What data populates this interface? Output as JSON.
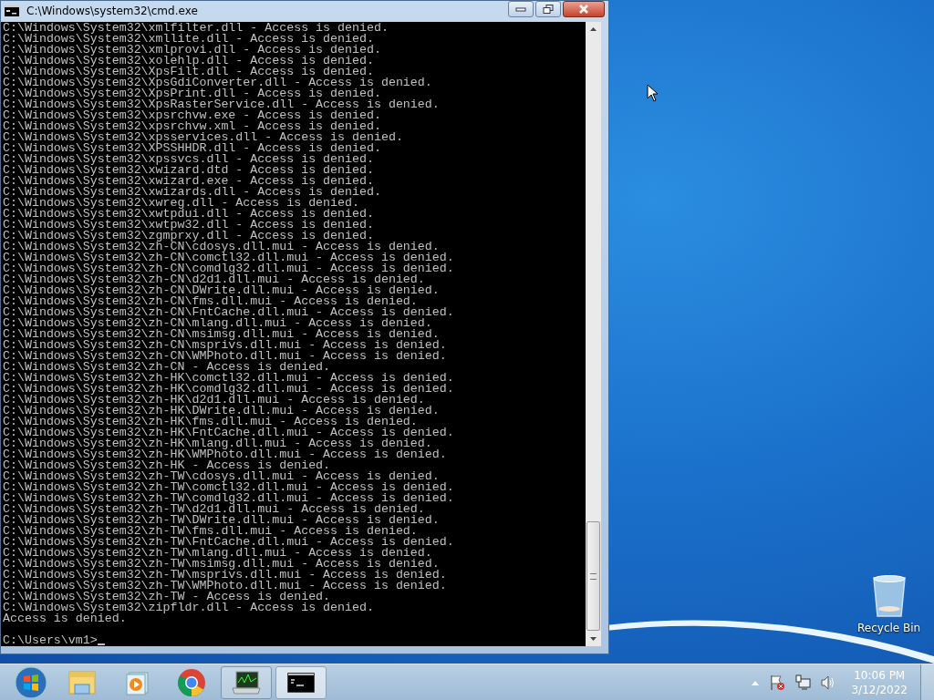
{
  "window": {
    "title": "C:\\Windows\\system32\\cmd.exe"
  },
  "console": {
    "lines": [
      "C:\\Windows\\System32\\xmlfilter.dll - Access is denied.",
      "C:\\Windows\\System32\\xmllite.dll - Access is denied.",
      "C:\\Windows\\System32\\xmlprovi.dll - Access is denied.",
      "C:\\Windows\\System32\\xolehlp.dll - Access is denied.",
      "C:\\Windows\\System32\\XpsFilt.dll - Access is denied.",
      "C:\\Windows\\System32\\XpsGdiConverter.dll - Access is denied.",
      "C:\\Windows\\System32\\XpsPrint.dll - Access is denied.",
      "C:\\Windows\\System32\\XpsRasterService.dll - Access is denied.",
      "C:\\Windows\\System32\\xpsrchvw.exe - Access is denied.",
      "C:\\Windows\\System32\\xpsrchvw.xml - Access is denied.",
      "C:\\Windows\\System32\\xpsservices.dll - Access is denied.",
      "C:\\Windows\\System32\\XPSSHHDR.dll - Access is denied.",
      "C:\\Windows\\System32\\xpssvcs.dll - Access is denied.",
      "C:\\Windows\\System32\\xwizard.dtd - Access is denied.",
      "C:\\Windows\\System32\\xwizard.exe - Access is denied.",
      "C:\\Windows\\System32\\xwizards.dll - Access is denied.",
      "C:\\Windows\\System32\\xwreg.dll - Access is denied.",
      "C:\\Windows\\System32\\xwtpdui.dll - Access is denied.",
      "C:\\Windows\\System32\\xwtpw32.dll - Access is denied.",
      "C:\\Windows\\System32\\zgmprxy.dll - Access is denied.",
      "C:\\Windows\\System32\\zh-CN\\cdosys.dll.mui - Access is denied.",
      "C:\\Windows\\System32\\zh-CN\\comctl32.dll.mui - Access is denied.",
      "C:\\Windows\\System32\\zh-CN\\comdlg32.dll.mui - Access is denied.",
      "C:\\Windows\\System32\\zh-CN\\d2d1.dll.mui - Access is denied.",
      "C:\\Windows\\System32\\zh-CN\\DWrite.dll.mui - Access is denied.",
      "C:\\Windows\\System32\\zh-CN\\fms.dll.mui - Access is denied.",
      "C:\\Windows\\System32\\zh-CN\\FntCache.dll.mui - Access is denied.",
      "C:\\Windows\\System32\\zh-CN\\mlang.dll.mui - Access is denied.",
      "C:\\Windows\\System32\\zh-CN\\msimsg.dll.mui - Access is denied.",
      "C:\\Windows\\System32\\zh-CN\\msprivs.dll.mui - Access is denied.",
      "C:\\Windows\\System32\\zh-CN\\WMPhoto.dll.mui - Access is denied.",
      "C:\\Windows\\System32\\zh-CN - Access is denied.",
      "C:\\Windows\\System32\\zh-HK\\comctl32.dll.mui - Access is denied.",
      "C:\\Windows\\System32\\zh-HK\\comdlg32.dll.mui - Access is denied.",
      "C:\\Windows\\System32\\zh-HK\\d2d1.dll.mui - Access is denied.",
      "C:\\Windows\\System32\\zh-HK\\DWrite.dll.mui - Access is denied.",
      "C:\\Windows\\System32\\zh-HK\\fms.dll.mui - Access is denied.",
      "C:\\Windows\\System32\\zh-HK\\FntCache.dll.mui - Access is denied.",
      "C:\\Windows\\System32\\zh-HK\\mlang.dll.mui - Access is denied.",
      "C:\\Windows\\System32\\zh-HK\\WMPhoto.dll.mui - Access is denied.",
      "C:\\Windows\\System32\\zh-HK - Access is denied.",
      "C:\\Windows\\System32\\zh-TW\\cdosys.dll.mui - Access is denied.",
      "C:\\Windows\\System32\\zh-TW\\comctl32.dll.mui - Access is denied.",
      "C:\\Windows\\System32\\zh-TW\\comdlg32.dll.mui - Access is denied.",
      "C:\\Windows\\System32\\zh-TW\\d2d1.dll.mui - Access is denied.",
      "C:\\Windows\\System32\\zh-TW\\DWrite.dll.mui - Access is denied.",
      "C:\\Windows\\System32\\zh-TW\\fms.dll.mui - Access is denied.",
      "C:\\Windows\\System32\\zh-TW\\FntCache.dll.mui - Access is denied.",
      "C:\\Windows\\System32\\zh-TW\\mlang.dll.mui - Access is denied.",
      "C:\\Windows\\System32\\zh-TW\\msimsg.dll.mui - Access is denied.",
      "C:\\Windows\\System32\\zh-TW\\msprivs.dll.mui - Access is denied.",
      "C:\\Windows\\System32\\zh-TW\\WMPhoto.dll.mui - Access is denied.",
      "C:\\Windows\\System32\\zh-TW - Access is denied.",
      "C:\\Windows\\System32\\zipfldr.dll - Access is denied.",
      "Access is denied."
    ],
    "prompt": "C:\\Users\\vm1>"
  },
  "desktop_icons": [
    {
      "label": "Recycle Bin"
    }
  ],
  "taskbar": {
    "items": [
      {
        "kind": "start",
        "running": false,
        "selected": false
      },
      {
        "kind": "explorer",
        "running": false,
        "selected": false
      },
      {
        "kind": "media",
        "running": false,
        "selected": false
      },
      {
        "kind": "browser",
        "running": false,
        "selected": false
      },
      {
        "kind": "monitor",
        "running": true,
        "selected": false
      },
      {
        "kind": "console",
        "running": true,
        "selected": true
      }
    ],
    "clock": {
      "time": "10:06 PM",
      "date": "3/12/2022"
    }
  }
}
